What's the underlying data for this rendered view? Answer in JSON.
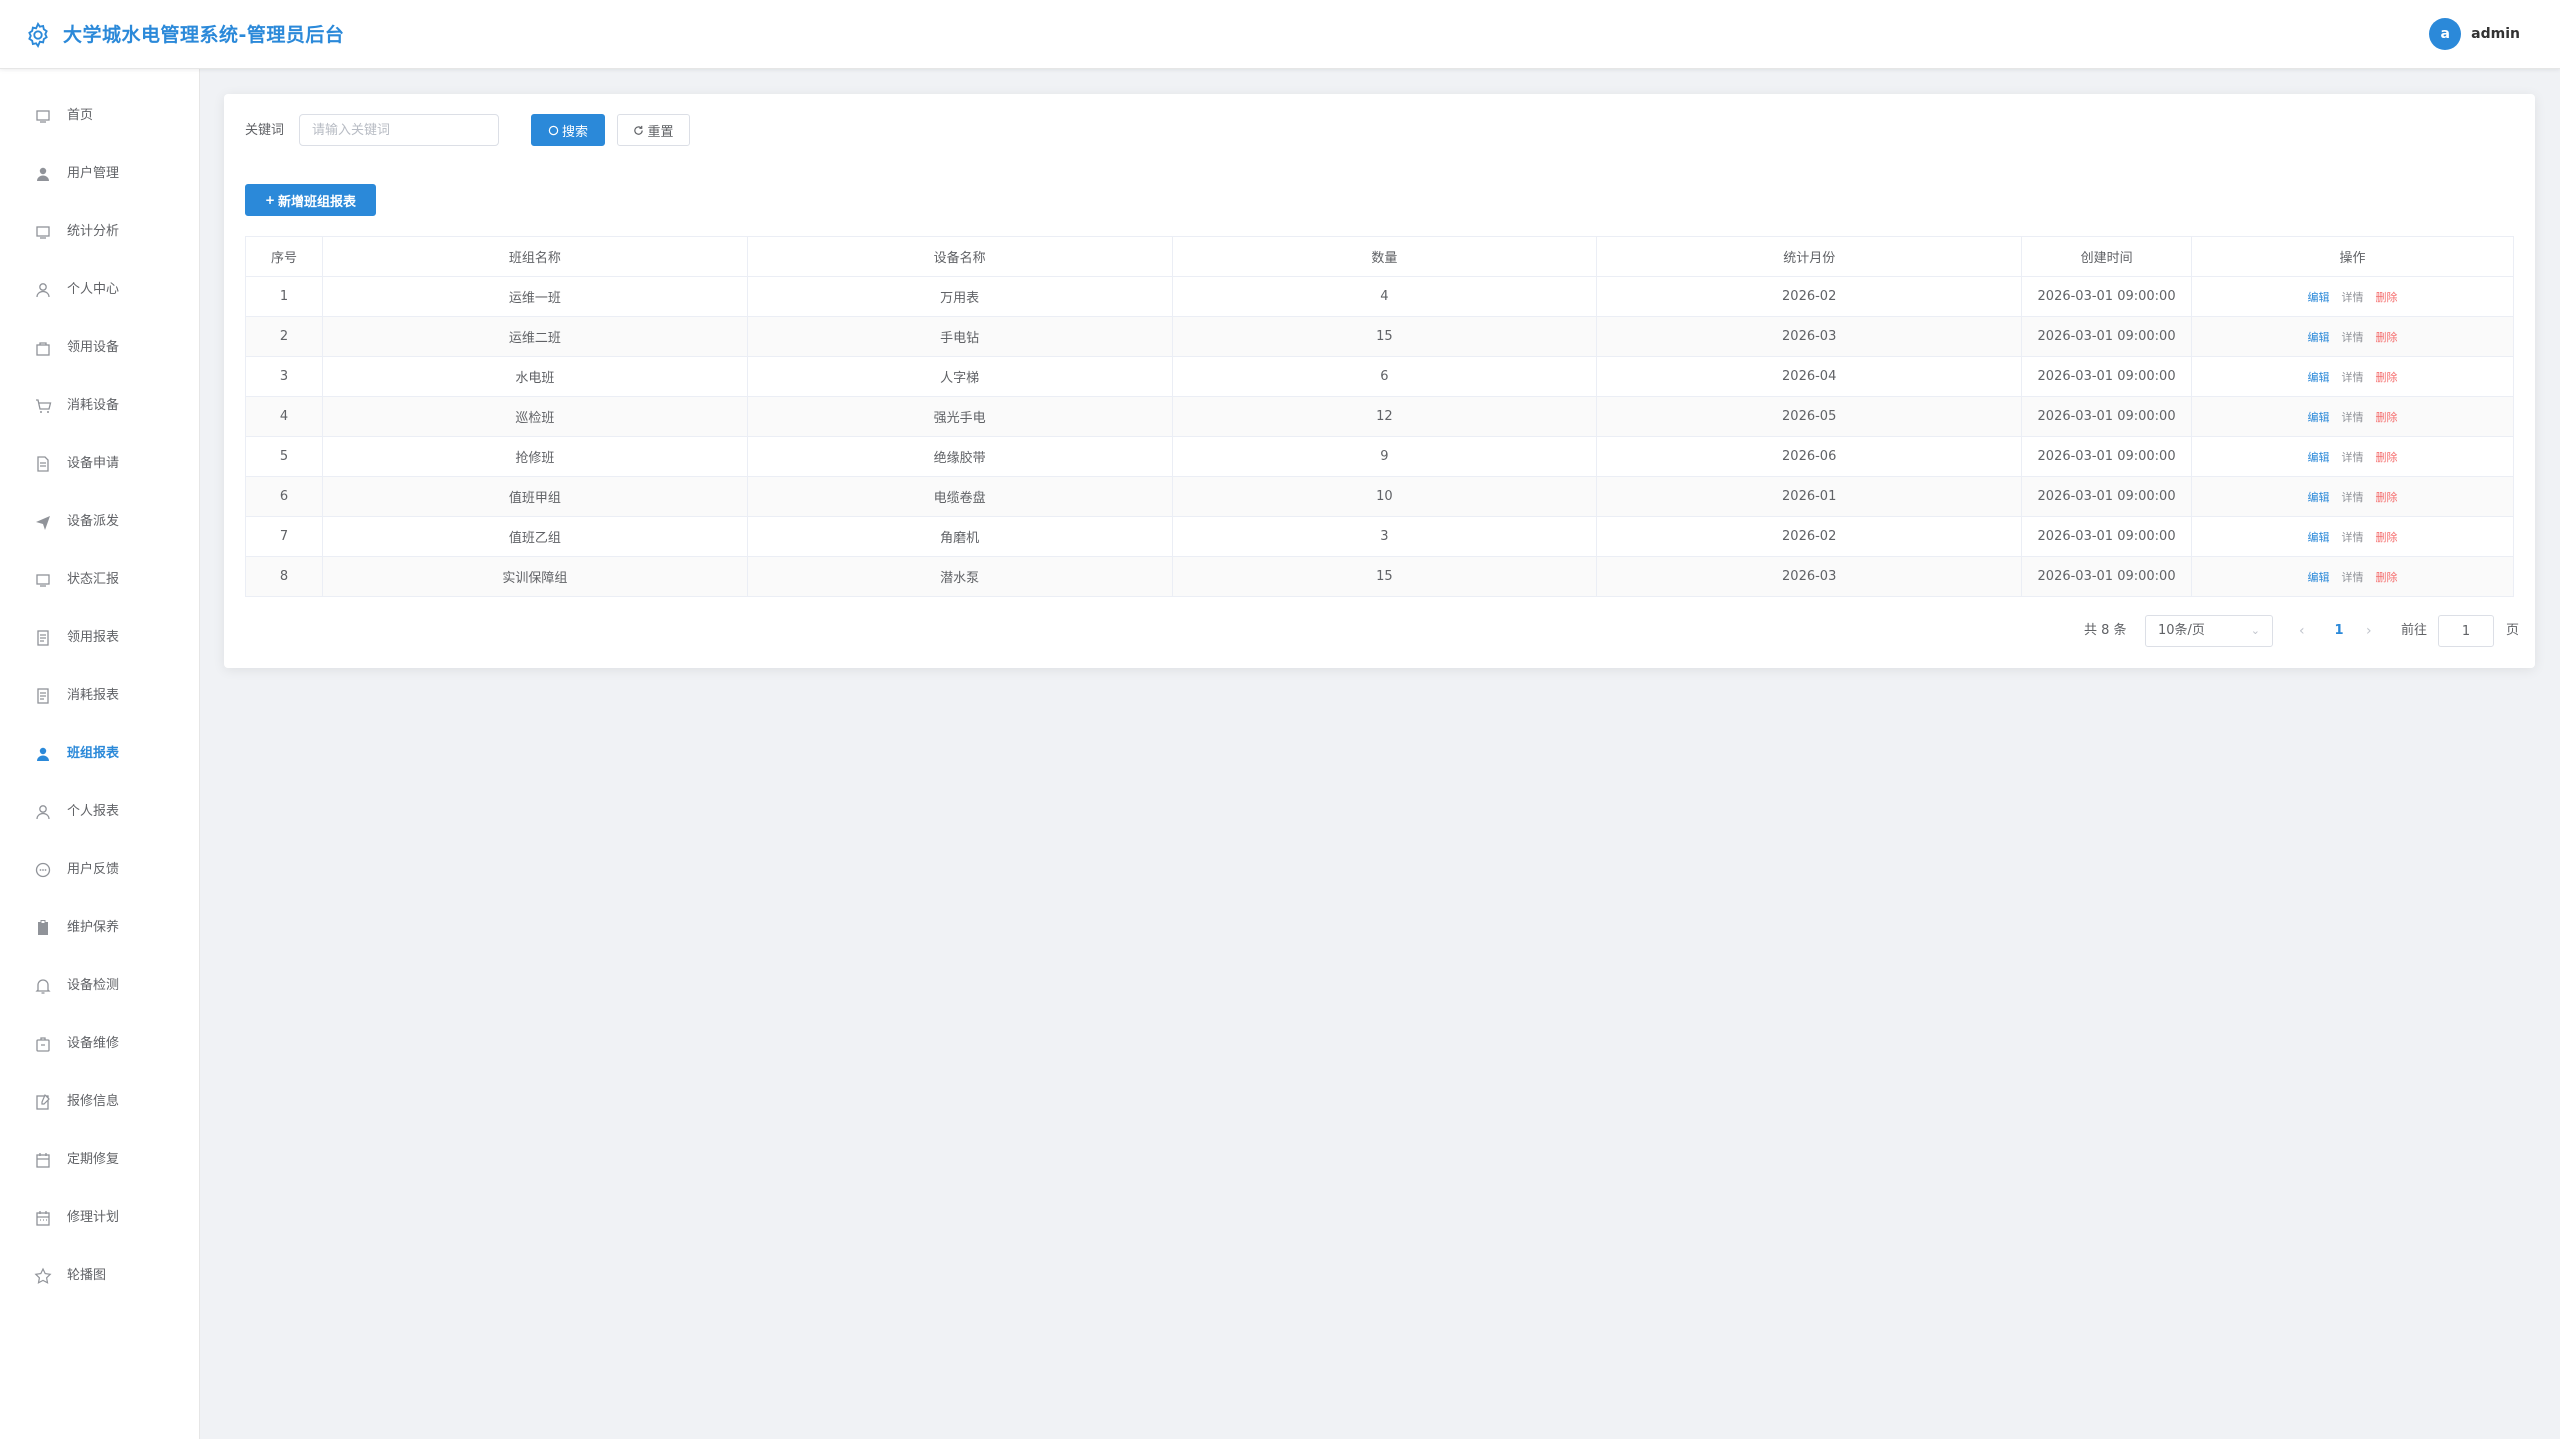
{
  "header": {
    "title": "大学城水电管理系统-管理员后台",
    "avatar_letter": "a",
    "username": "admin",
    "brand_color": "#2b89d9"
  },
  "sidebar": {
    "items": [
      {
        "label": "首页",
        "icon": "home-icon"
      },
      {
        "label": "用户管理",
        "icon": "user-icon"
      },
      {
        "label": "统计分析",
        "icon": "chart-icon"
      },
      {
        "label": "个人中心",
        "icon": "user-outline-icon"
      },
      {
        "label": "领用设备",
        "icon": "bag-icon"
      },
      {
        "label": "消耗设备",
        "icon": "cart-icon"
      },
      {
        "label": "设备申请",
        "icon": "document-icon"
      },
      {
        "label": "设备派发",
        "icon": "send-icon"
      },
      {
        "label": "状态汇报",
        "icon": "monitor-icon"
      },
      {
        "label": "领用报表",
        "icon": "report-icon"
      },
      {
        "label": "消耗报表",
        "icon": "report-icon"
      },
      {
        "label": "班组报表",
        "icon": "team-icon",
        "active": true
      },
      {
        "label": "个人报表",
        "icon": "person-icon"
      },
      {
        "label": "用户反馈",
        "icon": "chat-icon"
      },
      {
        "label": "维护保养",
        "icon": "clipboard-icon"
      },
      {
        "label": "设备检测",
        "icon": "bell-icon"
      },
      {
        "label": "设备维修",
        "icon": "toolbox-icon"
      },
      {
        "label": "报修信息",
        "icon": "edit-doc-icon"
      },
      {
        "label": "定期修复",
        "icon": "calendar-icon"
      },
      {
        "label": "修理计划",
        "icon": "calendar-grid-icon"
      },
      {
        "label": "轮播图",
        "icon": "star-icon"
      }
    ]
  },
  "search": {
    "label": "关键词",
    "placeholder": "请输入关键词",
    "search_label": "搜索",
    "reset_label": "重置",
    "add_label": "新增班组报表"
  },
  "table": {
    "columns": [
      "序号",
      "班组名称",
      "设备名称",
      "数量",
      "统计月份",
      "创建时间",
      "操作"
    ],
    "rows": [
      [
        "1",
        "运维一班",
        "万用表",
        "4",
        "2026-02",
        "2026-03-01 09:00:00"
      ],
      [
        "2",
        "运维二班",
        "手电钻",
        "15",
        "2026-03",
        "2026-03-01 09:00:00"
      ],
      [
        "3",
        "水电班",
        "人字梯",
        "6",
        "2026-04",
        "2026-03-01 09:00:00"
      ],
      [
        "4",
        "巡检班",
        "强光手电",
        "12",
        "2026-05",
        "2026-03-01 09:00:00"
      ],
      [
        "5",
        "抢修班",
        "绝缘胶带",
        "9",
        "2026-06",
        "2026-03-01 09:00:00"
      ],
      [
        "6",
        "值班甲组",
        "电缆卷盘",
        "10",
        "2026-01",
        "2026-03-01 09:00:00"
      ],
      [
        "7",
        "值班乙组",
        "角磨机",
        "3",
        "2026-02",
        "2026-03-01 09:00:00"
      ],
      [
        "8",
        "实训保障组",
        "潜水泵",
        "15",
        "2026-03",
        "2026-03-01 09:00:00"
      ]
    ],
    "actions": {
      "edit": "编辑",
      "detail": "详情",
      "delete": "删除"
    }
  },
  "pagination": {
    "total_text": "共 8 条",
    "page_size": "10条/页",
    "current_page": "1",
    "goto_label": "前往",
    "goto_value": "1",
    "page_suffix": "页"
  }
}
